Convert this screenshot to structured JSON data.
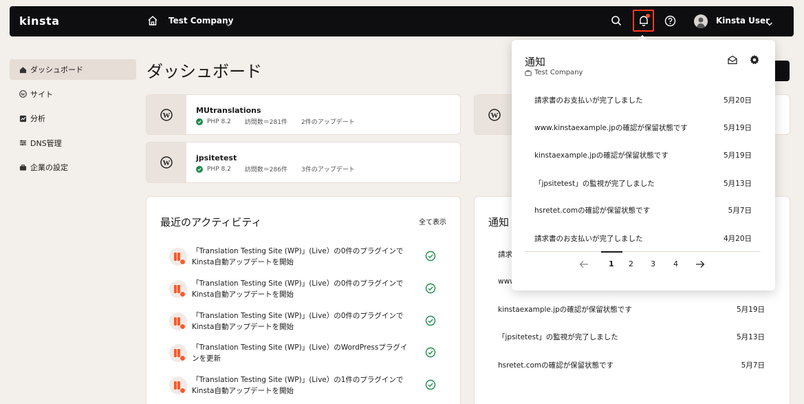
{
  "topbar": {
    "brand": "kinsta",
    "company": "Test Company",
    "user_name": "Kinsta User"
  },
  "sidebar": {
    "items": [
      {
        "label": "ダッシュボード",
        "icon": "home-icon",
        "active": true
      },
      {
        "label": "サイト",
        "icon": "wordpress-icon"
      },
      {
        "label": "分析",
        "icon": "analytics-icon"
      },
      {
        "label": "DNS管理",
        "icon": "dns-icon"
      },
      {
        "label": "企業の設定",
        "icon": "briefcase-icon"
      }
    ]
  },
  "main": {
    "title": "ダッシュボード",
    "sites": [
      {
        "name": "MUtranslations",
        "php": "PHP 8.2",
        "visits": "訪問数＝281件",
        "updates": "2件のアップデート"
      },
      {
        "name": "jpsitetest",
        "php": "PHP 8.2",
        "visits": "訪問数＝286件",
        "updates": "3件のアップデート"
      }
    ],
    "activity": {
      "title": "最近のアクティビティ",
      "view_all": "全て表示",
      "items": [
        {
          "line1": "「Translation Testing Site (WP)」(Live）の0件のプラグインで",
          "line2": "Kinsta自動アップデートを開始"
        },
        {
          "line1": "「Translation Testing Site (WP)」(Live）の0件のプラグインで",
          "line2": "Kinsta自動アップデートを開始"
        },
        {
          "line1": "「Translation Testing Site (WP)」(Live）の0件のプラグインで",
          "line2": "Kinsta自動アップデートを開始"
        },
        {
          "line1": "「Translation Testing Site (WP)」(Live）のWordPressプラグイ",
          "line2": "ンを更新"
        },
        {
          "line1": "「Translation Testing Site (WP)」(Live）の1件のプラグインで",
          "line2": "Kinsta自動アップデートを開始"
        }
      ]
    },
    "notifications_panel": {
      "title": "通知",
      "items": [
        {
          "text": "請求",
          "date": ""
        },
        {
          "text": "www",
          "date": ""
        },
        {
          "text": "kinstaexample.jpの確認が保留状態です",
          "date": "5月19日"
        },
        {
          "text": "「jpsitetest」の監視が完了しました",
          "date": "5月13日"
        },
        {
          "text": "hsretet.comの確認が保留状態です",
          "date": "5月7日"
        }
      ]
    }
  },
  "dropdown": {
    "title": "通知",
    "company": "Test Company",
    "items": [
      {
        "text": "請求書のお支払いが完了しました",
        "date": "5月20日"
      },
      {
        "text": "www.kinstaexample.jpの確認が保留状態です",
        "date": "5月19日"
      },
      {
        "text": "kinstaexample.jpの確認が保留状態です",
        "date": "5月19日"
      },
      {
        "text": "「jpsitetest」の監視が完了しました",
        "date": "5月13日"
      },
      {
        "text": "hsretet.comの確認が保留状態です",
        "date": "5月7日"
      },
      {
        "text": "請求書のお支払いが完了しました",
        "date": "4月20日"
      }
    ],
    "pages": [
      "1",
      "2",
      "3",
      "4"
    ],
    "current_page": "1"
  },
  "colors": {
    "topbar": "#0e0e11",
    "accent": "#ff5a2a",
    "highlight": "#ff3b1f",
    "background": "#f3efeb",
    "success": "#1f8a4c"
  }
}
